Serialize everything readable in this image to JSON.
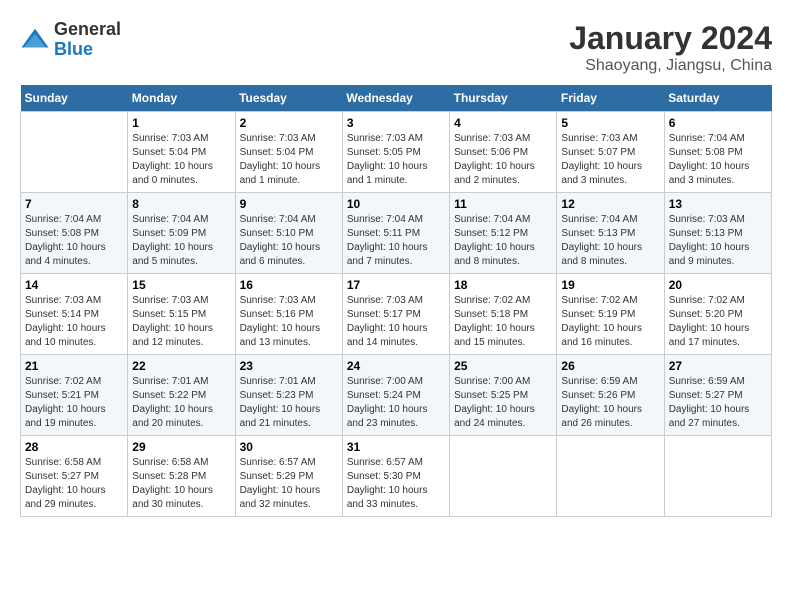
{
  "header": {
    "logo_general": "General",
    "logo_blue": "Blue",
    "month_title": "January 2024",
    "location": "Shaoyang, Jiangsu, China"
  },
  "weekdays": [
    "Sunday",
    "Monday",
    "Tuesday",
    "Wednesday",
    "Thursday",
    "Friday",
    "Saturday"
  ],
  "weeks": [
    [
      {
        "day": null
      },
      {
        "day": 1,
        "sunrise": "7:03 AM",
        "sunset": "5:04 PM",
        "daylight": "10 hours and 0 minutes."
      },
      {
        "day": 2,
        "sunrise": "7:03 AM",
        "sunset": "5:04 PM",
        "daylight": "10 hours and 1 minute."
      },
      {
        "day": 3,
        "sunrise": "7:03 AM",
        "sunset": "5:05 PM",
        "daylight": "10 hours and 1 minute."
      },
      {
        "day": 4,
        "sunrise": "7:03 AM",
        "sunset": "5:06 PM",
        "daylight": "10 hours and 2 minutes."
      },
      {
        "day": 5,
        "sunrise": "7:03 AM",
        "sunset": "5:07 PM",
        "daylight": "10 hours and 3 minutes."
      },
      {
        "day": 6,
        "sunrise": "7:04 AM",
        "sunset": "5:08 PM",
        "daylight": "10 hours and 3 minutes."
      }
    ],
    [
      {
        "day": 7,
        "sunrise": "7:04 AM",
        "sunset": "5:08 PM",
        "daylight": "10 hours and 4 minutes."
      },
      {
        "day": 8,
        "sunrise": "7:04 AM",
        "sunset": "5:09 PM",
        "daylight": "10 hours and 5 minutes."
      },
      {
        "day": 9,
        "sunrise": "7:04 AM",
        "sunset": "5:10 PM",
        "daylight": "10 hours and 6 minutes."
      },
      {
        "day": 10,
        "sunrise": "7:04 AM",
        "sunset": "5:11 PM",
        "daylight": "10 hours and 7 minutes."
      },
      {
        "day": 11,
        "sunrise": "7:04 AM",
        "sunset": "5:12 PM",
        "daylight": "10 hours and 8 minutes."
      },
      {
        "day": 12,
        "sunrise": "7:04 AM",
        "sunset": "5:13 PM",
        "daylight": "10 hours and 8 minutes."
      },
      {
        "day": 13,
        "sunrise": "7:03 AM",
        "sunset": "5:13 PM",
        "daylight": "10 hours and 9 minutes."
      }
    ],
    [
      {
        "day": 14,
        "sunrise": "7:03 AM",
        "sunset": "5:14 PM",
        "daylight": "10 hours and 10 minutes."
      },
      {
        "day": 15,
        "sunrise": "7:03 AM",
        "sunset": "5:15 PM",
        "daylight": "10 hours and 12 minutes."
      },
      {
        "day": 16,
        "sunrise": "7:03 AM",
        "sunset": "5:16 PM",
        "daylight": "10 hours and 13 minutes."
      },
      {
        "day": 17,
        "sunrise": "7:03 AM",
        "sunset": "5:17 PM",
        "daylight": "10 hours and 14 minutes."
      },
      {
        "day": 18,
        "sunrise": "7:02 AM",
        "sunset": "5:18 PM",
        "daylight": "10 hours and 15 minutes."
      },
      {
        "day": 19,
        "sunrise": "7:02 AM",
        "sunset": "5:19 PM",
        "daylight": "10 hours and 16 minutes."
      },
      {
        "day": 20,
        "sunrise": "7:02 AM",
        "sunset": "5:20 PM",
        "daylight": "10 hours and 17 minutes."
      }
    ],
    [
      {
        "day": 21,
        "sunrise": "7:02 AM",
        "sunset": "5:21 PM",
        "daylight": "10 hours and 19 minutes."
      },
      {
        "day": 22,
        "sunrise": "7:01 AM",
        "sunset": "5:22 PM",
        "daylight": "10 hours and 20 minutes."
      },
      {
        "day": 23,
        "sunrise": "7:01 AM",
        "sunset": "5:23 PM",
        "daylight": "10 hours and 21 minutes."
      },
      {
        "day": 24,
        "sunrise": "7:00 AM",
        "sunset": "5:24 PM",
        "daylight": "10 hours and 23 minutes."
      },
      {
        "day": 25,
        "sunrise": "7:00 AM",
        "sunset": "5:25 PM",
        "daylight": "10 hours and 24 minutes."
      },
      {
        "day": 26,
        "sunrise": "6:59 AM",
        "sunset": "5:26 PM",
        "daylight": "10 hours and 26 minutes."
      },
      {
        "day": 27,
        "sunrise": "6:59 AM",
        "sunset": "5:27 PM",
        "daylight": "10 hours and 27 minutes."
      }
    ],
    [
      {
        "day": 28,
        "sunrise": "6:58 AM",
        "sunset": "5:27 PM",
        "daylight": "10 hours and 29 minutes."
      },
      {
        "day": 29,
        "sunrise": "6:58 AM",
        "sunset": "5:28 PM",
        "daylight": "10 hours and 30 minutes."
      },
      {
        "day": 30,
        "sunrise": "6:57 AM",
        "sunset": "5:29 PM",
        "daylight": "10 hours and 32 minutes."
      },
      {
        "day": 31,
        "sunrise": "6:57 AM",
        "sunset": "5:30 PM",
        "daylight": "10 hours and 33 minutes."
      },
      {
        "day": null
      },
      {
        "day": null
      },
      {
        "day": null
      }
    ]
  ],
  "labels": {
    "sunrise": "Sunrise:",
    "sunset": "Sunset:",
    "daylight": "Daylight:"
  }
}
